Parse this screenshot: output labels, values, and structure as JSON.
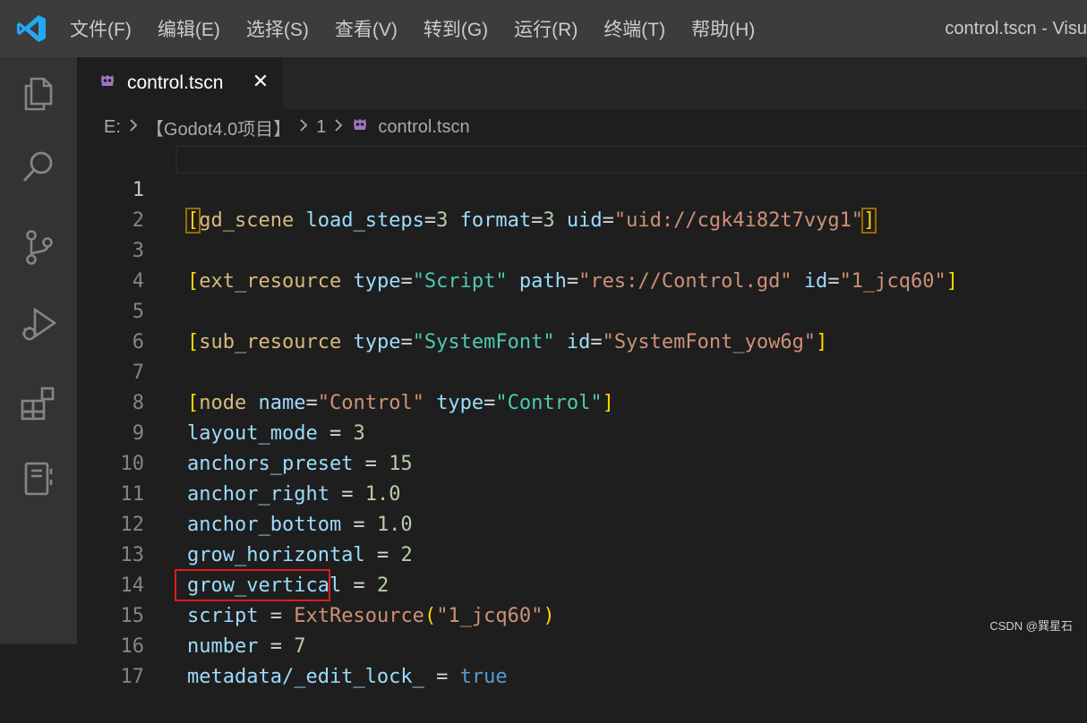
{
  "menu": [
    "文件(F)",
    "编辑(E)",
    "选择(S)",
    "查看(V)",
    "转到(G)",
    "运行(R)",
    "终端(T)",
    "帮助(H)"
  ],
  "window_title": "control.tscn - Visu",
  "activity_icons": [
    "explorer-icon",
    "search-icon",
    "source-control-icon",
    "run-debug-icon",
    "extensions-icon",
    "notebook-icon"
  ],
  "tab": {
    "label": "control.tscn",
    "close": "✕"
  },
  "breadcrumb": {
    "drive": "E:",
    "folder": "【Godot4.0项目】",
    "subfolder": "1",
    "file": "control.tscn"
  },
  "lines": [
    {
      "n": "1"
    },
    {
      "n": "2"
    },
    {
      "n": "3"
    },
    {
      "n": "4"
    },
    {
      "n": "5"
    },
    {
      "n": "6"
    },
    {
      "n": "7"
    },
    {
      "n": "8"
    },
    {
      "n": "9"
    },
    {
      "n": "10"
    },
    {
      "n": "11"
    },
    {
      "n": "12"
    },
    {
      "n": "13"
    },
    {
      "n": "14"
    },
    {
      "n": "15"
    },
    {
      "n": "16"
    },
    {
      "n": "17"
    }
  ],
  "code": {
    "l1": {
      "tag": "gd_scene",
      "a1": "load_steps",
      "v1": "3",
      "a2": "format",
      "v2": "3",
      "a3": "uid",
      "v3": "\"uid://cgk4i82t7vyg1\""
    },
    "l3": {
      "tag": "ext_resource",
      "a1": "type",
      "v1": "\"Script\"",
      "a2": "path",
      "v2": "\"res://Control.gd\"",
      "a3": "id",
      "v3": "\"1_jcq60\""
    },
    "l5": {
      "tag": "sub_resource",
      "a1": "type",
      "v1": "\"SystemFont\"",
      "a2": "id",
      "v2": "\"SystemFont_yow6g\""
    },
    "l7": {
      "tag": "node",
      "a1": "name",
      "v1": "\"Control\"",
      "a2": "type",
      "v2": "\"Control\""
    },
    "l8": {
      "k": "layout_mode",
      "v": "3"
    },
    "l9": {
      "k": "anchors_preset",
      "v": "15"
    },
    "l10": {
      "k": "anchor_right",
      "v": "1.0"
    },
    "l11": {
      "k": "anchor_bottom",
      "v": "1.0"
    },
    "l12": {
      "k": "grow_horizontal",
      "v": "2"
    },
    "l13": {
      "k": "grow_vertical",
      "v": "2"
    },
    "l14": {
      "k": "script",
      "f": "ExtResource",
      "arg": "\"1_jcq60\""
    },
    "l15": {
      "k": "number",
      "v": "7"
    },
    "l16": {
      "k": "metadata/_edit_lock_",
      "v": "true"
    }
  },
  "watermark": "CSDN @巽星石",
  "colors": {
    "highlight": "#e01b1b",
    "accent": "#0078d4"
  }
}
